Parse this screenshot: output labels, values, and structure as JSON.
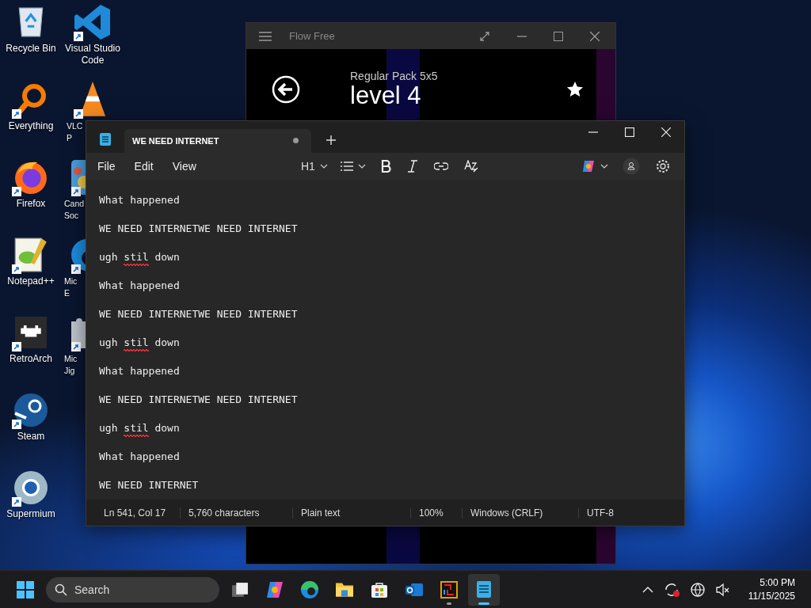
{
  "desktop_icons": {
    "column_1": [
      {
        "kind": "recycle",
        "label": [
          "Recycle Bin"
        ],
        "shortcut": false
      },
      {
        "kind": "everything",
        "label": [
          "Everything"
        ],
        "shortcut": true
      },
      {
        "kind": "firefox",
        "label": [
          "Firefox"
        ],
        "shortcut": true
      },
      {
        "kind": "notepadpp",
        "label": [
          "Notepad++"
        ],
        "shortcut": true
      },
      {
        "kind": "retroarch",
        "label": [
          "RetroArch"
        ],
        "shortcut": true
      },
      {
        "kind": "steam",
        "label": [
          "Steam"
        ],
        "shortcut": true
      },
      {
        "kind": "supermium",
        "label": [
          "Supermium"
        ],
        "shortcut": true
      }
    ],
    "column_2": [
      {
        "kind": "vscode",
        "label": [
          "Visual Studio",
          "Code"
        ],
        "shortcut": true
      },
      {
        "kind": "vlc",
        "label": [
          "VLC",
          "P"
        ],
        "shortcut": true
      },
      {
        "kind": "candy",
        "label": [
          "Cand",
          "Soc"
        ],
        "shortcut": true
      },
      {
        "kind": "edge",
        "label": [
          "Mic",
          "E"
        ],
        "shortcut": true
      },
      {
        "kind": "jigsaw",
        "label": [
          "Mic",
          "Jig"
        ],
        "shortcut": true
      }
    ]
  },
  "flow_free": {
    "title": "Flow Free",
    "subtitle": "Regular Pack 5x5",
    "level": "level 4"
  },
  "notepad": {
    "tab": {
      "title": "WE NEED INTERNET",
      "unsaved": true
    },
    "menus": [
      "File",
      "Edit",
      "View"
    ],
    "heading_button": "H1",
    "lines": [
      {
        "text": "What happened"
      },
      {
        "text": "WE NEED INTERNETWE NEED INTERNET"
      },
      {
        "segments": [
          {
            "text": "ugh ",
            "misspelled": false
          },
          {
            "text": "stil",
            "misspelled": true
          },
          {
            "text": " down",
            "misspelled": false
          }
        ]
      },
      {
        "text": "What happened"
      },
      {
        "text": "WE NEED INTERNETWE NEED INTERNET"
      },
      {
        "segments": [
          {
            "text": "ugh ",
            "misspelled": false
          },
          {
            "text": "stil",
            "misspelled": true
          },
          {
            "text": " down",
            "misspelled": false
          }
        ]
      },
      {
        "text": "What happened"
      },
      {
        "text": "WE NEED INTERNETWE NEED INTERNET"
      },
      {
        "segments": [
          {
            "text": "ugh ",
            "misspelled": false
          },
          {
            "text": "stil",
            "misspelled": true
          },
          {
            "text": " down",
            "misspelled": false
          }
        ]
      },
      {
        "text": "What happened"
      },
      {
        "text": "WE NEED INTERNET"
      }
    ],
    "status_bar": [
      "Ln 541, Col 17",
      "5,760 characters",
      "Plain text",
      "100%",
      "Windows (CRLF)",
      "UTF-8"
    ]
  },
  "taskbar": {
    "search": {
      "placeholder": "Search"
    },
    "apps": [
      {
        "kind": "taskview",
        "active": false
      },
      {
        "kind": "copilot",
        "active": false
      },
      {
        "kind": "edge",
        "active": false
      },
      {
        "kind": "explorer",
        "active": false
      },
      {
        "kind": "store",
        "active": false
      },
      {
        "kind": "outlook",
        "active": false
      },
      {
        "kind": "game",
        "active": false,
        "running": true
      },
      {
        "kind": "notepad",
        "active": true,
        "running": true
      }
    ],
    "clock": {
      "time": "5:00 PM",
      "date": "11/15/2025"
    }
  }
}
